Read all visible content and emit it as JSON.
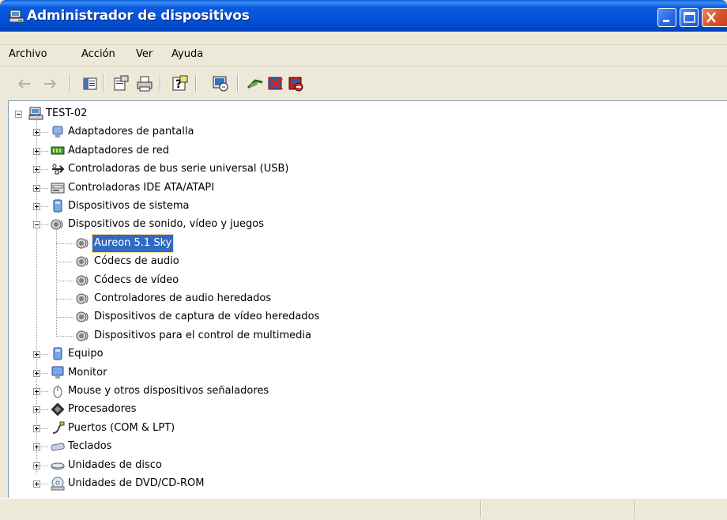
{
  "window": {
    "title": "Administrador de dispositivos"
  },
  "menu": [
    "Archivo",
    "Acción",
    "Ver",
    "Ayuda"
  ],
  "toolbar": {
    "icons": [
      "back-icon",
      "forward-icon",
      "console-tree-icon",
      "properties-icon",
      "print-icon",
      "help-icon",
      "scan-hardware-icon",
      "update-driver-icon",
      "uninstall-icon",
      "disable-icon"
    ]
  },
  "tree": {
    "root": "TEST-02",
    "items": [
      {
        "label": "Adaptadores de pantalla",
        "icon": "display-adapter-icon",
        "expanded": false
      },
      {
        "label": "Adaptadores de red",
        "icon": "network-adapter-icon",
        "expanded": false
      },
      {
        "label": "Controladoras de bus serie universal (USB)",
        "icon": "usb-icon",
        "expanded": false
      },
      {
        "label": "Controladoras IDE ATA/ATAPI",
        "icon": "ide-controller-icon",
        "expanded": false
      },
      {
        "label": "Dispositivos de sistema",
        "icon": "system-device-icon",
        "expanded": false
      },
      {
        "label": "Dispositivos de sonido, vídeo y juegos",
        "icon": "sound-icon",
        "expanded": true,
        "children": [
          {
            "label": "Aureon 5.1 Sky",
            "selected": true
          },
          {
            "label": "Códecs de audio",
            "selected": false
          },
          {
            "label": "Códecs de vídeo",
            "selected": false
          },
          {
            "label": "Controladores de audio heredados",
            "selected": false
          },
          {
            "label": "Dispositivos de captura de vídeo heredados",
            "selected": false
          },
          {
            "label": "Dispositivos para el control de multimedia",
            "selected": false
          }
        ]
      },
      {
        "label": "Equipo",
        "icon": "computer-icon",
        "expanded": false
      },
      {
        "label": "Monitor",
        "icon": "monitor-icon",
        "expanded": false
      },
      {
        "label": "Mouse y otros dispositivos señaladores",
        "icon": "mouse-icon",
        "expanded": false
      },
      {
        "label": "Procesadores",
        "icon": "processor-icon",
        "expanded": false
      },
      {
        "label": "Puertos (COM & LPT)",
        "icon": "port-icon",
        "expanded": false
      },
      {
        "label": "Teclados",
        "icon": "keyboard-icon",
        "expanded": false
      },
      {
        "label": "Unidades de disco",
        "icon": "disk-drive-icon",
        "expanded": false
      },
      {
        "label": "Unidades de DVD/CD-ROM",
        "icon": "dvd-icon",
        "expanded": false
      }
    ]
  }
}
